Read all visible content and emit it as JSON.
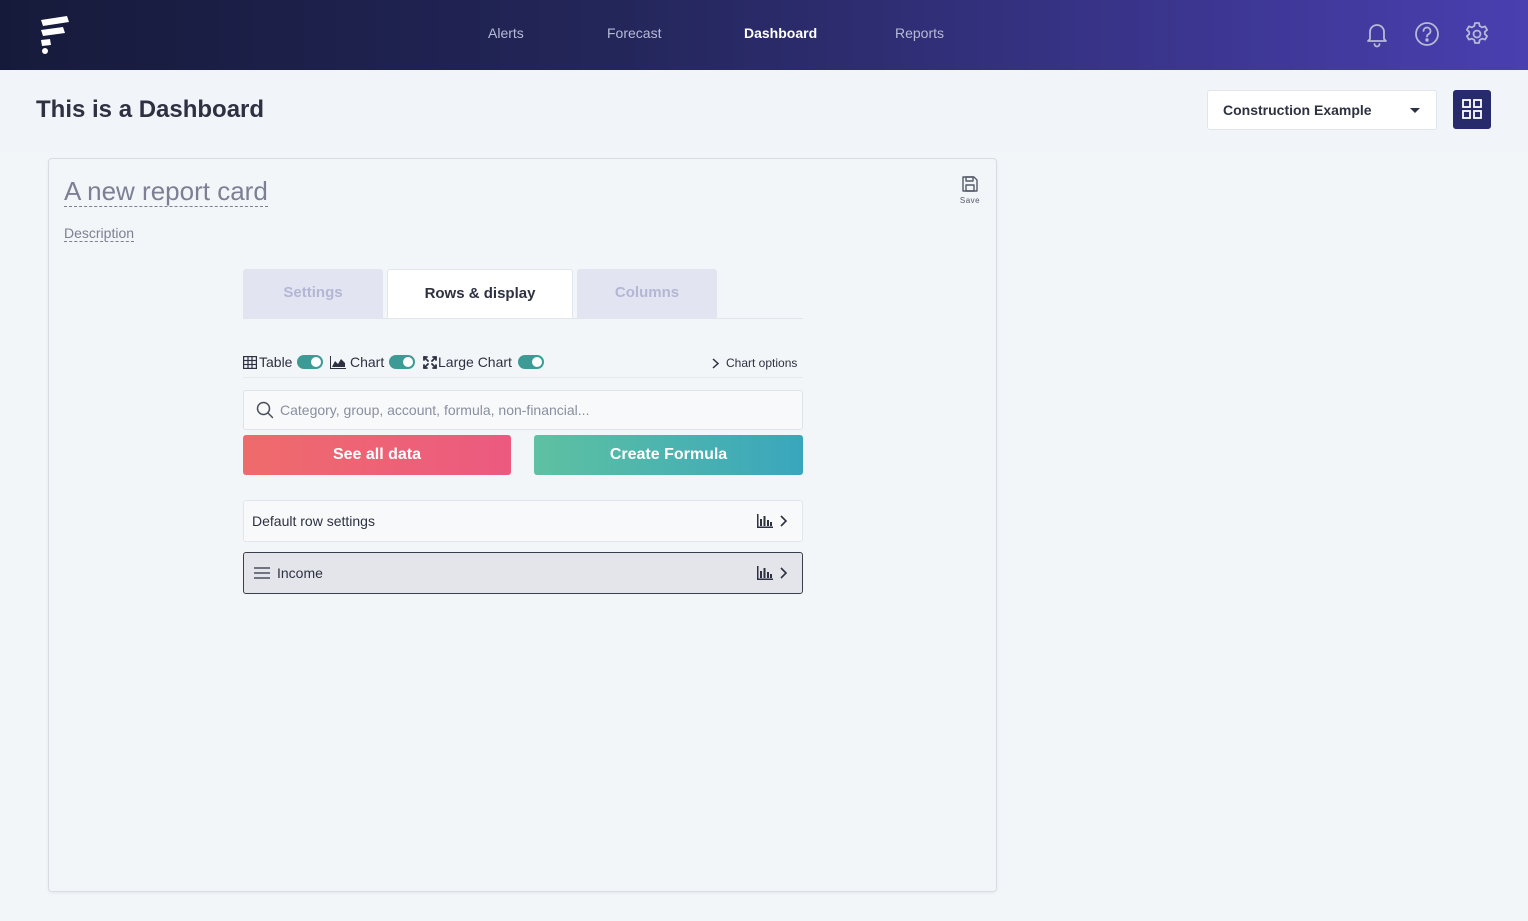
{
  "nav": {
    "items": [
      {
        "label": "Alerts",
        "active": false
      },
      {
        "label": "Forecast",
        "active": false
      },
      {
        "label": "Dashboard",
        "active": true
      },
      {
        "label": "Reports",
        "active": false
      }
    ],
    "icons": [
      "bell-icon",
      "help-icon",
      "gear-icon"
    ]
  },
  "header": {
    "title": "This is a Dashboard",
    "company_select": "Construction Example",
    "grid_icon": "grid-icon"
  },
  "card": {
    "title": "A new report card",
    "description": "Description",
    "save_label": "Save"
  },
  "tabs": [
    {
      "label": "Settings",
      "active": false
    },
    {
      "label": "Rows & display",
      "active": true
    },
    {
      "label": "Columns",
      "active": false
    }
  ],
  "display": {
    "table_label": "Table",
    "table_on": true,
    "chart_label": "Chart",
    "chart_on": true,
    "large_chart_label": "Large Chart",
    "large_chart_on": true,
    "chart_options_label": "Chart options"
  },
  "search": {
    "placeholder": "Category, group, account, formula, non-financial..."
  },
  "actions": {
    "see_all_label": "See all data",
    "create_formula_label": "Create Formula"
  },
  "rows": [
    {
      "label": "Default row settings"
    },
    {
      "label": "Income"
    }
  ],
  "colors": {
    "accent": "#272a6b",
    "toggle": "#3d9b95",
    "red_start": "#ef6b6b",
    "red_end": "#ec5a80",
    "green_start": "#5ec1a1",
    "green_end": "#3aa6bd"
  }
}
